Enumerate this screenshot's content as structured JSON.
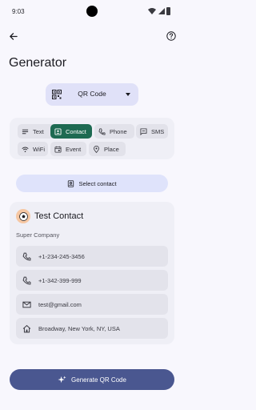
{
  "status_bar": {
    "time": "9:03"
  },
  "header": {
    "title": "Generator"
  },
  "code_type": {
    "selected": "QR Code"
  },
  "content_types": [
    {
      "label": "Text",
      "icon": "text-icon",
      "active": false
    },
    {
      "label": "Contact",
      "icon": "contact-card-icon",
      "active": true
    },
    {
      "label": "Phone",
      "icon": "phone-icon",
      "active": false
    },
    {
      "label": "SMS",
      "icon": "sms-icon",
      "active": false
    },
    {
      "label": "WiFi",
      "icon": "wifi-icon",
      "active": false
    },
    {
      "label": "Event",
      "icon": "event-icon",
      "active": false
    },
    {
      "label": "Place",
      "icon": "place-icon",
      "active": false
    }
  ],
  "select_contact": {
    "label": "Select contact"
  },
  "contact": {
    "name": "Test Contact",
    "company": "Super Company",
    "phone1": "+1-234-245-3456",
    "phone2": "+1-342-399-999",
    "email": "test@gmail.com",
    "address": "Broadway, New York, NY, USA"
  },
  "generate_button": {
    "label": "Generate QR Code"
  },
  "colors": {
    "accent_active": "#1e6a52",
    "primary_button": "#4a5790",
    "dropdown_bg": "#e0e1f8"
  }
}
